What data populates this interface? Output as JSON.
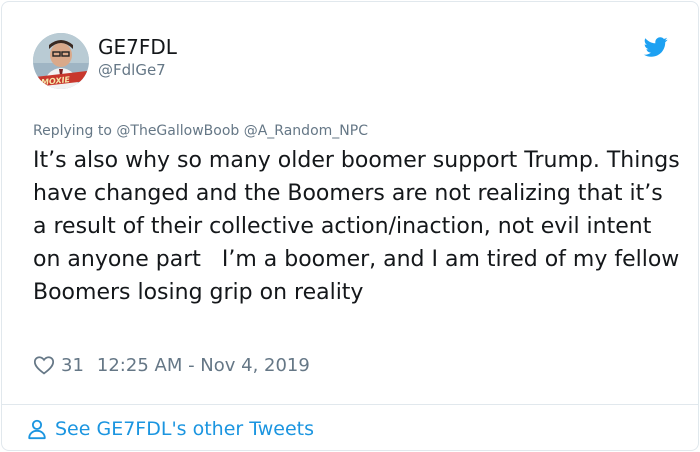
{
  "author": {
    "display_name": "GE7FDL",
    "handle": "@FdlGe7",
    "avatar_icon": "profile-photo",
    "avatar_caption": "MOXIE"
  },
  "reply": {
    "prefix": "Replying to",
    "mentions": [
      "@TheGallowBoob",
      "@A_Random_NPC"
    ]
  },
  "tweet": {
    "text": "It’s also why so many older boomer support Trump. Things have changed and the Boomers are not realizing that it’s a result of their collective action/inaction, not evil intent on anyone part   I’m a boomer, and I am tired of my fellow Boomers losing grip on reality"
  },
  "meta": {
    "like_icon": "heart-icon",
    "likes": "31",
    "timestamp": "12:25 AM - Nov 4, 2019"
  },
  "footer": {
    "link_icon": "person-icon",
    "link_text": "See GE7FDL's other Tweets"
  },
  "colors": {
    "link_blue": "#1b95e0",
    "twitter_blue": "#1da1f2",
    "secondary_text": "#657786",
    "border": "#e1e8ed"
  }
}
